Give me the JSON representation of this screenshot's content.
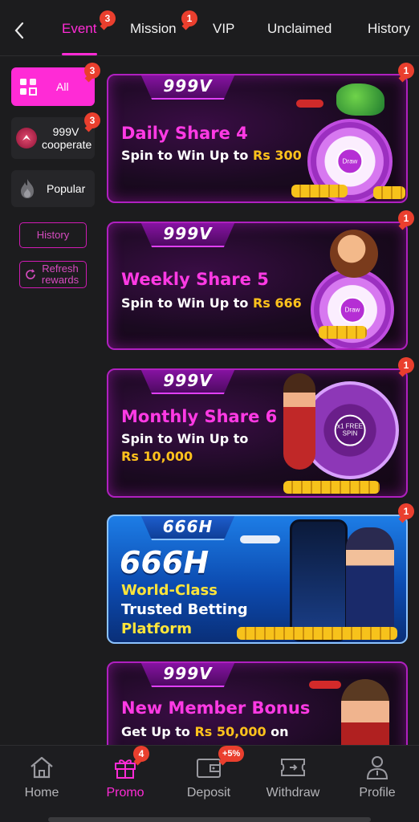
{
  "tabs": [
    {
      "label": "Event",
      "badge": "3",
      "active": true
    },
    {
      "label": "Mission",
      "badge": "1"
    },
    {
      "label": "VIP"
    },
    {
      "label": "Unclaimed"
    },
    {
      "label": "History"
    }
  ],
  "sidebar": {
    "all": {
      "label": "All",
      "badge": "3"
    },
    "coop": {
      "label": "999V cooperate",
      "badge": "3"
    },
    "popular": {
      "label": "Popular"
    },
    "history_btn": "History",
    "refresh_btn": "Refresh rewards"
  },
  "cards": [
    {
      "brand": "999V",
      "badge": "1",
      "title": "Daily Share 4",
      "sub_prefix": "Spin to Win Up to ",
      "sub_amount": "Rs 300",
      "wheel_center": "Draw"
    },
    {
      "brand": "999V",
      "badge": "1",
      "title": "Weekly Share 5",
      "sub_prefix": "Spin to Win Up to ",
      "sub_amount": "Rs 666",
      "wheel_center": "Draw"
    },
    {
      "brand": "999V",
      "badge": "1",
      "title": "Monthly Share 6",
      "sub_prefix": "Spin to Win Up to",
      "sub_amount": "Rs 10,000",
      "wheel_center": "x1 FREE SPIN"
    },
    {
      "brand": "666H",
      "badge": "1",
      "big_brand": "666H",
      "line1": "World-Class",
      "line2": "Trusted Betting",
      "line3": "Platform"
    },
    {
      "brand": "999V",
      "title": "New Member Bonus",
      "sub_prefix": "Get Up to ",
      "sub_amount": "Rs 50,000",
      "sub_suffix": " on"
    }
  ],
  "bottom_nav": [
    {
      "label": "Home",
      "icon": "home-icon"
    },
    {
      "label": "Promo",
      "icon": "gift-icon",
      "badge": "4",
      "active": true
    },
    {
      "label": "Deposit",
      "icon": "wallet-icon",
      "badge": "+5%"
    },
    {
      "label": "Withdraw",
      "icon": "ticket-icon"
    },
    {
      "label": "Profile",
      "icon": "user-icon"
    }
  ],
  "colors": {
    "accent": "#ff2bd6",
    "badge": "#ea3f2e",
    "gold": "#ffc21c"
  }
}
